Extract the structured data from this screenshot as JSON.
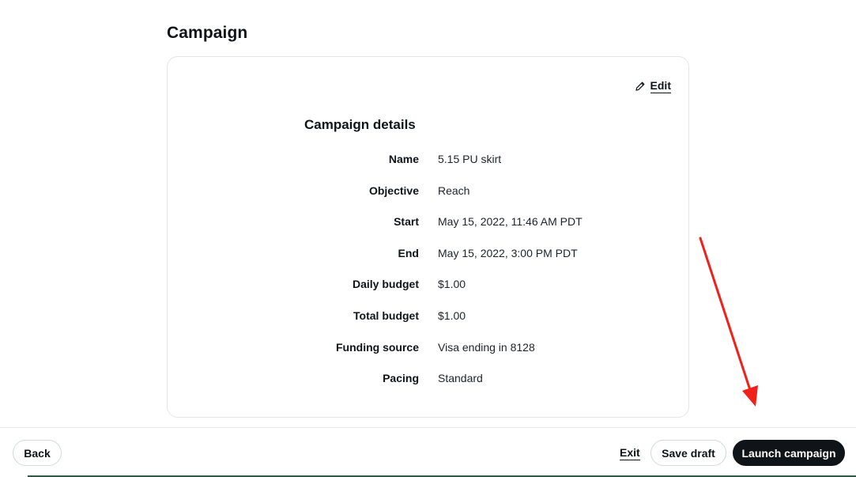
{
  "section": {
    "title": "Campaign"
  },
  "card": {
    "edit_label": "Edit",
    "heading": "Campaign details",
    "details": [
      {
        "label": "Name",
        "value": "5.15 PU skirt"
      },
      {
        "label": "Objective",
        "value": "Reach"
      },
      {
        "label": "Start",
        "value": "May 15, 2022, 11:46 AM PDT"
      },
      {
        "label": "End",
        "value": "May 15, 2022, 3:00 PM PDT"
      },
      {
        "label": "Daily budget",
        "value": "$1.00"
      },
      {
        "label": "Total budget",
        "value": "$1.00"
      },
      {
        "label": "Funding source",
        "value": "Visa ending in 8128"
      },
      {
        "label": "Pacing",
        "value": "Standard"
      }
    ]
  },
  "footer": {
    "back_label": "Back",
    "exit_label": "Exit",
    "save_draft_label": "Save draft",
    "launch_label": "Launch campaign"
  },
  "colors": {
    "text": "#0f1419",
    "card_border": "#e3e6ea",
    "button_dark": "#0f1419",
    "annotation_arrow": "#f0201a"
  },
  "icons": {
    "edit": "pencil-icon",
    "annotation": "red-arrow-icon"
  }
}
